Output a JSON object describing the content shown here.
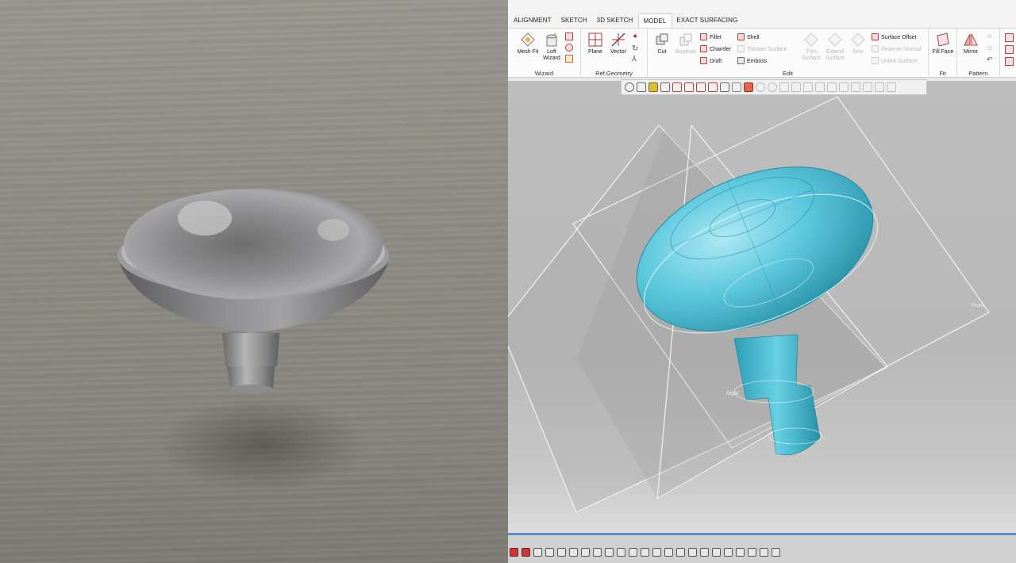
{
  "tabs": [
    {
      "label": "ALIGNMENT",
      "active": false
    },
    {
      "label": "SKETCH",
      "active": false
    },
    {
      "label": "3D SKETCH",
      "active": false
    },
    {
      "label": "MODEL",
      "active": true
    },
    {
      "label": "EXACT SURFACING",
      "active": false
    }
  ],
  "ribbon": {
    "wizard": {
      "label": "Wizard",
      "mesh_fit": "Mesh Fit",
      "loft_wizard": "Loft Wizard"
    },
    "ref_geometry": {
      "label": "Ref.Geometry",
      "plane": "Plane",
      "vector": "Vector"
    },
    "edit": {
      "label": "Edit",
      "cut": "Cut",
      "boolean": "Boolean",
      "fillet": "Fillet",
      "chamfer": "Chamfer",
      "draft": "Draft",
      "shell": "Shell",
      "thicken_surface": "Thicken Surface",
      "emboss": "Emboss",
      "trim_surface": "Trim Surface",
      "extend_surface": "Extend Surface",
      "sew": "Sew",
      "surface_offset": "Surface Offset",
      "reverse_normal": "Reverse Normal",
      "unlink_surface": "Unlink Surface"
    },
    "fit": {
      "label": "Fit",
      "fill_face": "Fill Face"
    },
    "pattern": {
      "label": "Pattern",
      "mirror": "Mirror"
    }
  },
  "viewport": {
    "plane_front": "Front",
    "plane_right": "Right"
  },
  "colors": {
    "model_cyan": "#4fc6dc",
    "viewport_bg": "#bdbdbd",
    "accent_blue": "#5b8ec7"
  }
}
